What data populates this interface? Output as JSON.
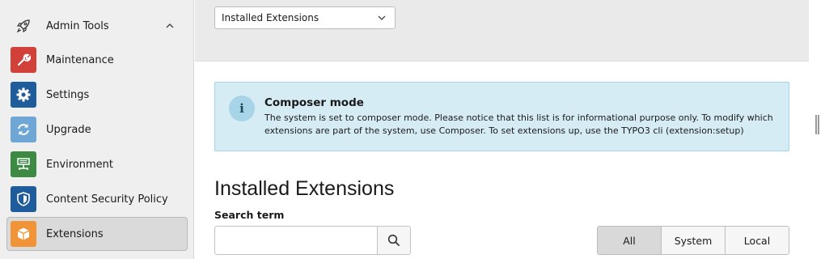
{
  "sidebar": {
    "group": {
      "label": "Admin Tools",
      "icon": "rocket-icon"
    },
    "items": [
      {
        "label": "Maintenance",
        "icon": "wrench-icon",
        "color": "#d1413a"
      },
      {
        "label": "Settings",
        "icon": "gear-icon",
        "color": "#1f5c9c"
      },
      {
        "label": "Upgrade",
        "icon": "refresh-icon",
        "color": "#6ea6d6"
      },
      {
        "label": "Environment",
        "icon": "server-icon",
        "color": "#3d8a45"
      },
      {
        "label": "Content Security Policy",
        "icon": "shield-icon",
        "color": "#1f5c9c"
      },
      {
        "label": "Extensions",
        "icon": "box-icon",
        "color": "#f09437",
        "active": true
      }
    ]
  },
  "header": {
    "module_select": {
      "value": "Installed Extensions"
    }
  },
  "callout": {
    "title": "Composer mode",
    "text": "The system is set to composer mode. Please notice that this list is for informational purpose only. To modify which extensions are part of the system, use Composer. To set extensions up, use the TYPO3 cli (extension:setup)",
    "icon": "info-icon"
  },
  "main": {
    "heading": "Installed Extensions",
    "search": {
      "label": "Search term",
      "value": "",
      "placeholder": ""
    },
    "filters": [
      "All",
      "System",
      "Local"
    ],
    "active_filter": "All"
  }
}
